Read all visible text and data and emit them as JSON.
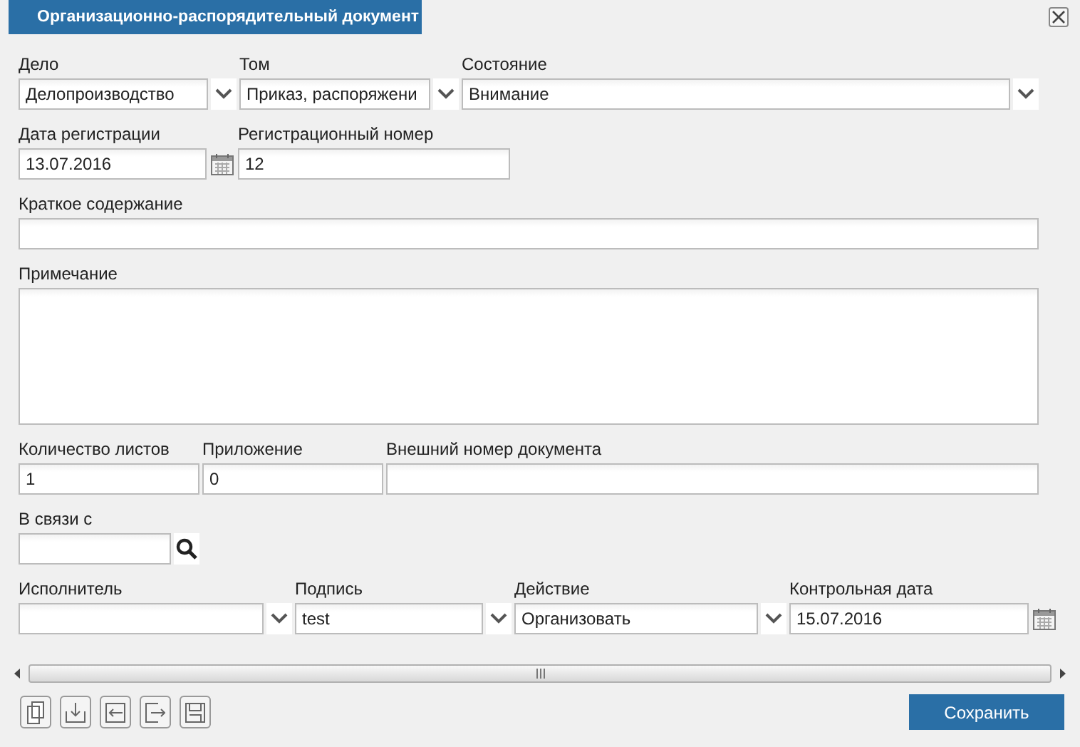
{
  "window": {
    "title": "Организационно-распорядительный документ"
  },
  "rows": [
    {
      "fields": [
        {
          "label": "Дело",
          "kind": "combo",
          "value": "Делопроизводство"
        },
        {
          "label": "Том",
          "kind": "combo",
          "value": "Приказ, распоряжени"
        },
        {
          "label": "Состояние",
          "kind": "combo",
          "value": "Внимание"
        }
      ]
    },
    {
      "fields": [
        {
          "label": "Дата регистрации",
          "kind": "date",
          "value": "13.07.2016"
        },
        {
          "label": "Регистрационный номер",
          "kind": "text",
          "value": "12"
        }
      ]
    },
    {
      "fields": [
        {
          "label": "Краткое содержание",
          "kind": "text"
        }
      ]
    },
    {
      "fields": [
        {
          "label": "Примечание",
          "kind": "textarea"
        }
      ]
    },
    {
      "fields": [
        {
          "label": "Количество листов",
          "kind": "text",
          "value": "1"
        },
        {
          "label": "Приложение",
          "kind": "text",
          "value": "0"
        },
        {
          "label": "Внешний номер документа",
          "kind": "text"
        }
      ]
    },
    {
      "fields": [
        {
          "label": "В связи с",
          "kind": "lookup"
        }
      ]
    },
    {
      "fields": [
        {
          "label": "Исполнитель",
          "kind": "combo"
        },
        {
          "label": "Подпись",
          "kind": "combo",
          "value": "test"
        },
        {
          "label": "Действие",
          "kind": "combo",
          "value": "Организовать"
        },
        {
          "label": "Контрольная дата",
          "kind": "date",
          "value": "15.07.2016"
        }
      ]
    }
  ],
  "save_button": "Сохранить"
}
